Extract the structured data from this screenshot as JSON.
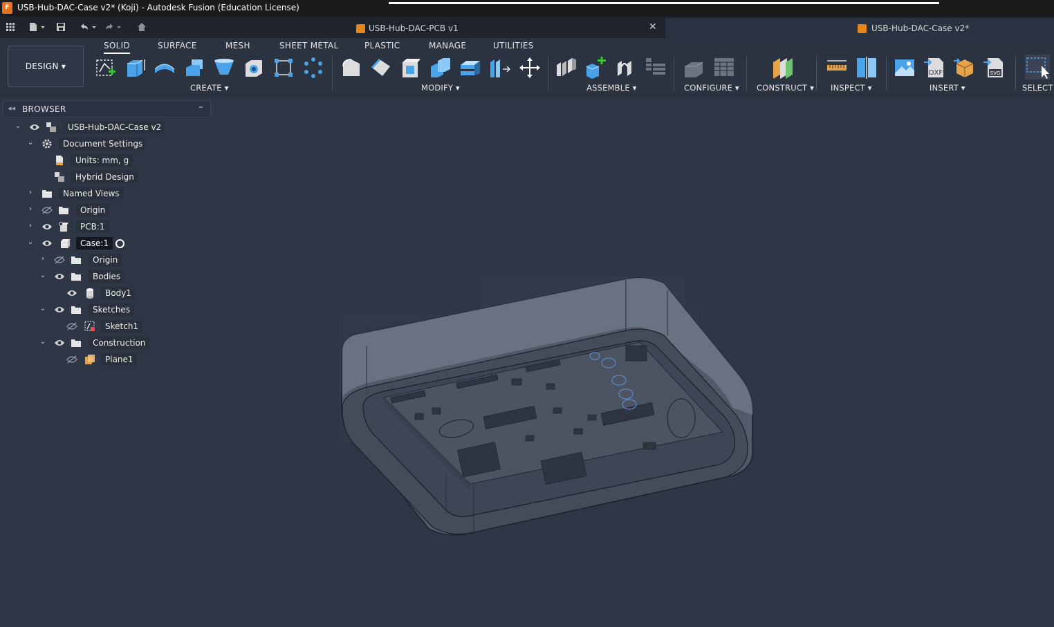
{
  "window": {
    "title": "USB-Hub-DAC-Case v2* (Koji) - Autodesk Fusion (Education License)",
    "logo_text": "F"
  },
  "quick_access": {
    "icons": [
      "grid-icon",
      "file-icon",
      "save-icon",
      "undo-icon",
      "redo-icon",
      "home-icon"
    ]
  },
  "tabs": [
    {
      "label": "USB-Hub-DAC-PCB v1",
      "active": false
    },
    {
      "label": "USB-Hub-DAC-Case v2*",
      "active": true
    }
  ],
  "tab_close_glyph": "✕",
  "workspace": {
    "label": "DESIGN ▾"
  },
  "ribbon_tabs": [
    "SOLID",
    "SURFACE",
    "MESH",
    "SHEET METAL",
    "PLASTIC",
    "MANAGE",
    "UTILITIES"
  ],
  "ribbon_groups": [
    {
      "label": "CREATE ▾"
    },
    {
      "label": "MODIFY ▾"
    },
    {
      "label": "ASSEMBLE ▾"
    },
    {
      "label": "CONFIGURE ▾"
    },
    {
      "label": "CONSTRUCT ▾"
    },
    {
      "label": "INSPECT ▾"
    },
    {
      "label": "INSERT ▾"
    },
    {
      "label": "SELECT ▾"
    }
  ],
  "insert_icon_text": {
    "dxf": "DXF",
    "svg": "SVG"
  },
  "browser": {
    "title": "BROWSER",
    "collapse_glyph": "◂◂",
    "minimize_glyph": "–",
    "items": [
      {
        "label": "USB-Hub-DAC-Case v2",
        "chevron": "⌄",
        "visible": true
      },
      {
        "label": "Document Settings",
        "chevron": "⌄"
      },
      {
        "label": "Units: mm, g"
      },
      {
        "label": "Hybrid Design"
      },
      {
        "label": "Named Views",
        "chevron": "›"
      },
      {
        "label": "Origin",
        "chevron": "›",
        "visible": false
      },
      {
        "label": "PCB:1",
        "chevron": "›",
        "visible": true
      },
      {
        "label": "Case:1",
        "chevron": "⌄",
        "visible": true,
        "selected": true
      },
      {
        "label": "Origin",
        "chevron": "›",
        "visible": false
      },
      {
        "label": "Bodies",
        "chevron": "⌄",
        "visible": true
      },
      {
        "label": "Body1",
        "visible": true
      },
      {
        "label": "Sketches",
        "chevron": "⌄",
        "visible": true
      },
      {
        "label": "Sketch1",
        "visible": false
      },
      {
        "label": "Construction",
        "chevron": "⌄",
        "visible": true
      },
      {
        "label": "Plane1",
        "visible": false
      }
    ]
  },
  "colors": {
    "accent_blue": "#4aa3e8",
    "viewport_bg": "#2f3746",
    "ribbon_bg": "#2b3240",
    "fusion_orange": "#e8731c"
  }
}
